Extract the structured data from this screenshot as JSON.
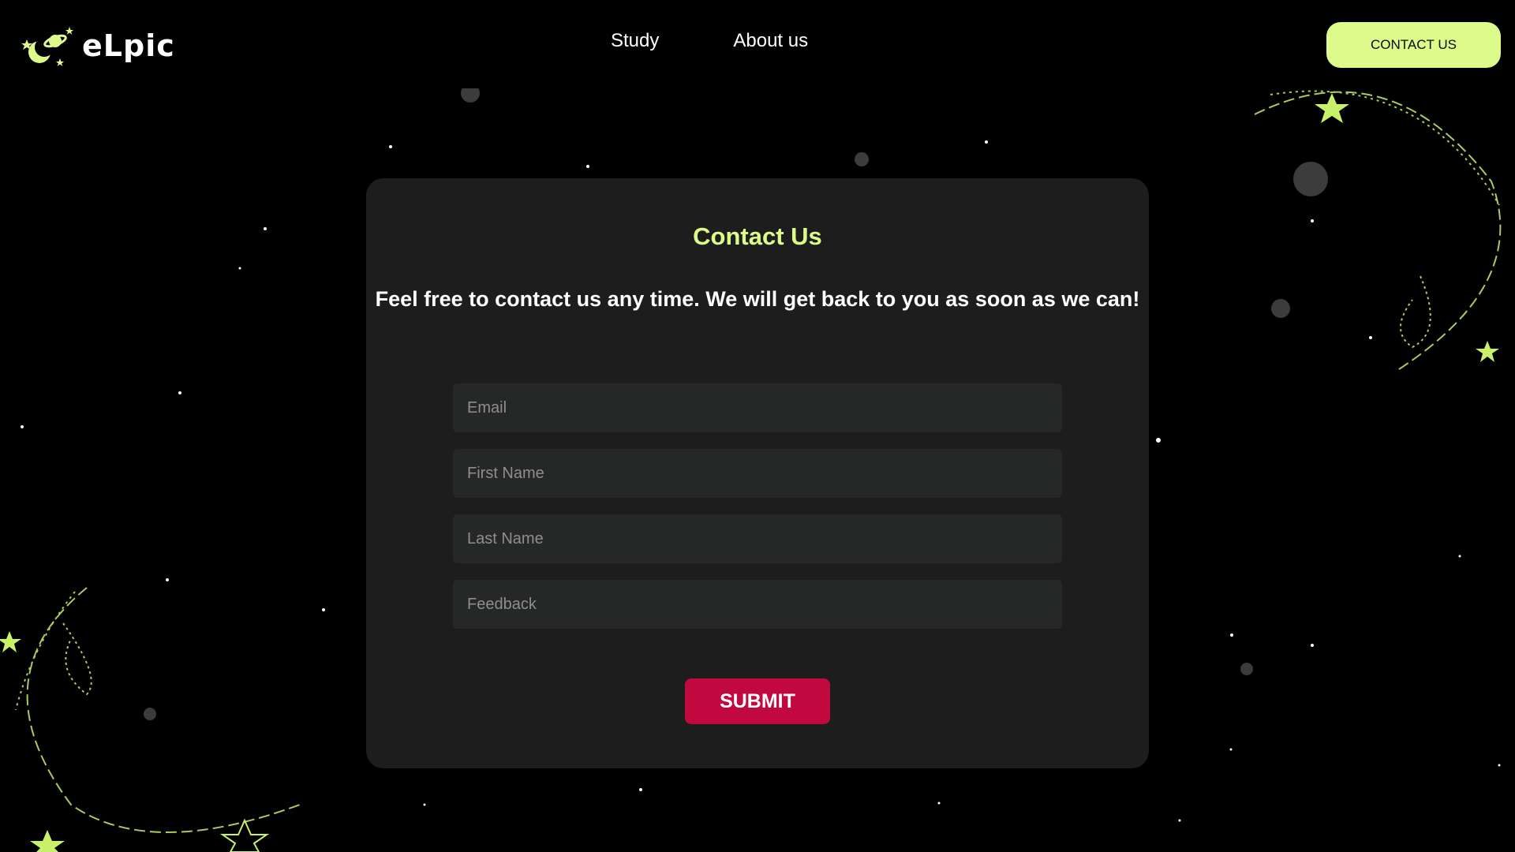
{
  "brand": {
    "name": "eLpic"
  },
  "nav": {
    "items": [
      {
        "label": "Study"
      },
      {
        "label": "About us"
      }
    ]
  },
  "header": {
    "contact_label": "CONTACT US"
  },
  "contact": {
    "title": "Contact Us",
    "subtitle": "Feel free to contact us any time. We will get back to you as soon as we can!",
    "fields": {
      "email": {
        "placeholder": "Email",
        "value": ""
      },
      "first_name": {
        "placeholder": "First Name",
        "value": ""
      },
      "last_name": {
        "placeholder": "Last Name",
        "value": ""
      },
      "feedback": {
        "placeholder": "Feedback",
        "value": ""
      }
    },
    "submit_label": "SUBMIT"
  },
  "colors": {
    "background": "#000000",
    "accent": "#ddfb8a",
    "card": "#1d1d1d",
    "field": "#262827",
    "submit": "#c1083f"
  }
}
